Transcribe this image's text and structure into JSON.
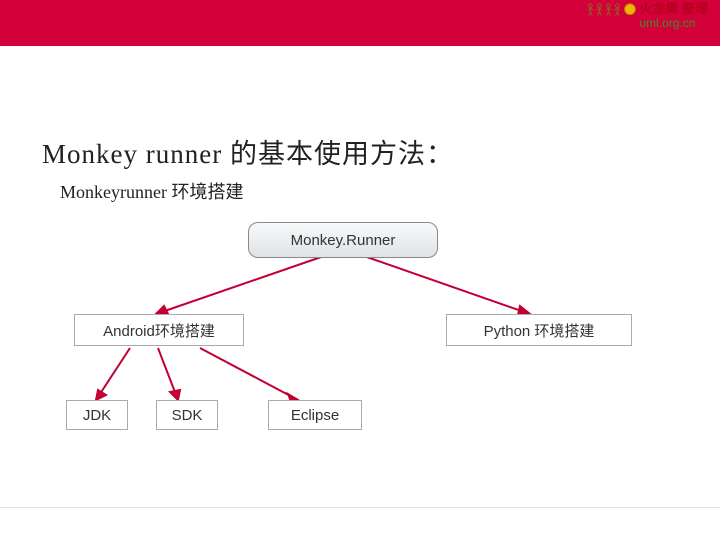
{
  "logo": {
    "line1": "火龙果 整理",
    "url": "uml.org.cn"
  },
  "title": "Monkey runner 的基本使用方法：",
  "subtitle": "Monkeyrunner 环境搭建",
  "nodes": {
    "root": "Monkey.Runner",
    "mid_left": "Android环境搭建",
    "mid_right": "Python 环境搭建",
    "leaf1": "JDK",
    "leaf2": "SDK",
    "leaf3": "Eclipse"
  },
  "colors": {
    "banner": "#d4003a",
    "line": "#c20034"
  },
  "chart_data": {
    "type": "table",
    "structure": "tree",
    "root": "Monkey.Runner",
    "children": [
      {
        "label": "Android环境搭建",
        "children": [
          {
            "label": "JDK"
          },
          {
            "label": "SDK"
          },
          {
            "label": "Eclipse"
          }
        ]
      },
      {
        "label": "Python 环境搭建",
        "children": []
      }
    ]
  }
}
